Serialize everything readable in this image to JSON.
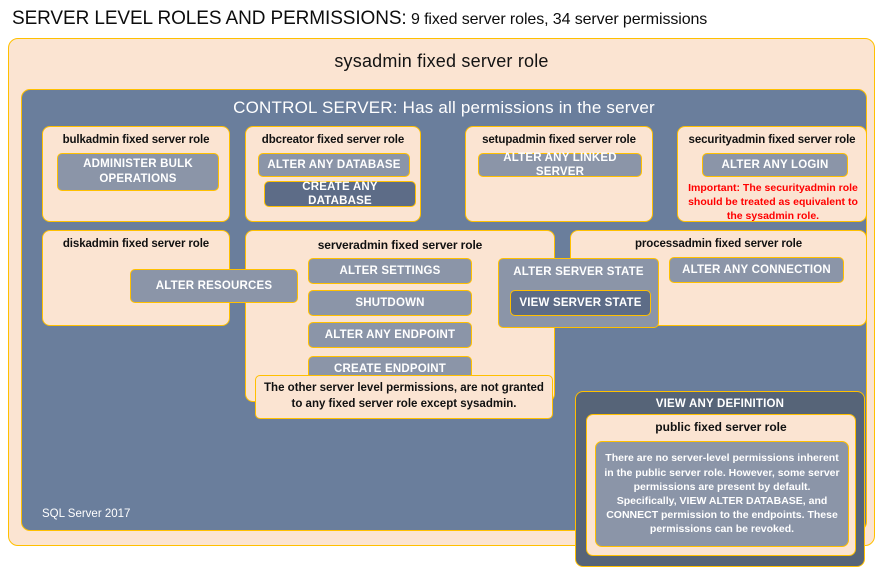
{
  "header": {
    "title_strong": "SERVER LEVEL ROLES AND PERMISSIONS:",
    "title_rest": " 9 fixed server roles, 34 server permissions"
  },
  "sysadmin": {
    "label": "sysadmin fixed server role"
  },
  "control_server": {
    "label": "CONTROL SERVER: Has all permissions in the server",
    "footer": "SQL Server 2017"
  },
  "roles": {
    "bulkadmin": {
      "title": "bulkadmin fixed server role",
      "permission": "ADMINISTER  BULK OPERATIONS"
    },
    "dbcreator": {
      "title": "dbcreator fixed server role",
      "permission_1": "ALTER ANY DATABASE",
      "permission_2": "CREATE  ANY DATABASE"
    },
    "setupadmin": {
      "title": "setupadmin fixed server role",
      "permission": "ALTER ANY LINKED SERVER"
    },
    "securityadmin": {
      "title": "securityadmin fixed server role",
      "permission": "ALTER ANY LOGIN",
      "warning": "Important:  The securityadmin role should  be treated as equivalent to the  sysadmin role."
    },
    "diskadmin": {
      "title": "diskadmin fixed server role",
      "permission": "ALTER RESOURCES"
    },
    "serveradmin": {
      "title": "serveradmin fixed server role",
      "permission_1": "ALTER SETTINGS",
      "permission_2": "SHUTDOWN",
      "permission_3": "ALTER ANY ENDPOINT",
      "permission_4": "CREATE  ENDPOINT"
    },
    "shared": {
      "alter_server_state": "ALTER SERVER STATE",
      "view_server_state": "VIEW SERVER STATE"
    },
    "processadmin": {
      "title": "processadmin fixed server role",
      "permission": "ALTER ANY CONNECTION"
    },
    "public": {
      "view_any_definition": "VIEW ANY DEFINITION",
      "title": "public fixed server role",
      "description": "There are no server-level permissions inherent in the public server role. However, some server permissions are present by default. Specifically, VIEW ALTER DATABASE, and CONNECT permission to the endpoints. These permissions can be revoked."
    }
  },
  "notes": {
    "other_permissions": "The other server level permissions,  are not granted to any fixed server role except sysadmin."
  },
  "colors": {
    "peach": "#fbe4d2",
    "gold_border": "#ffc000",
    "slate_panel": "#6a7e9c",
    "pill_gray": "#8b95a8",
    "pill_dark": "#5d6c87",
    "warning_red": "#ff0000",
    "definition_box": "#566478"
  }
}
